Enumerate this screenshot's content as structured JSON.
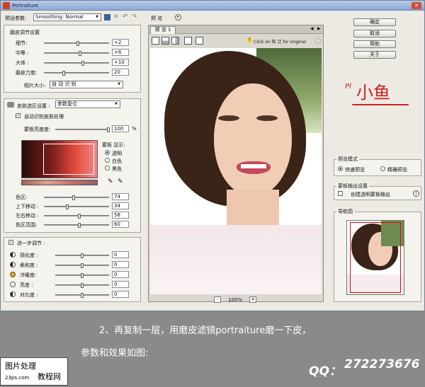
{
  "app": {
    "title": "Portraiture"
  },
  "left": {
    "preset_label": "预设参数:",
    "preset_value": "Smoothing: Normal",
    "smoothing": {
      "title": "磨皮调节设置",
      "rows": [
        {
          "label": "细节:",
          "value": "+2",
          "level": 0.52
        },
        {
          "label": "中等 :",
          "value": "+6",
          "level": 0.56
        },
        {
          "label": "大体 :",
          "value": "+10",
          "level": 0.6
        },
        {
          "label": "磨皮力度:",
          "value": "20",
          "level": 0.3
        }
      ],
      "threshold_label": "相片大小:",
      "threshold_value": "自 动 识 别"
    },
    "skin": {
      "title": "皮肤选区设置 :",
      "mode_value": "参数复位",
      "auto_label": "自动识别皮肤处理",
      "opacity_label": "蒙板亮度度:",
      "opacity_value": "100",
      "opacity_unit": "%",
      "mask_title": "蒙板 显示:",
      "mask_options": [
        "透明",
        "白色",
        "黑色"
      ],
      "rows": [
        {
          "label": "色区:",
          "value": "74",
          "level": 0.45
        },
        {
          "label": "上下移动 :",
          "value": "34",
          "level": 0.35
        },
        {
          "label": "左右移动 :",
          "value": "58",
          "level": 0.55
        },
        {
          "label": "色区范围:",
          "value": "60",
          "level": 0.55
        }
      ]
    },
    "enhance": {
      "title": "进一步调节 :",
      "rows": [
        {
          "label": "锐化度 :",
          "value": "0"
        },
        {
          "label": "柔和度 :",
          "value": "0"
        },
        {
          "label": "冷暖度:",
          "value": "0"
        },
        {
          "label": "亮度 :",
          "value": "0"
        },
        {
          "label": "对比度 :",
          "value": "0"
        }
      ]
    }
  },
  "preview": {
    "title": "预 览",
    "tab": "预 览 1",
    "hint": "Click on 恢 泛 for original",
    "zoom": "100%",
    "zoom_minus": "-",
    "zoom_plus": "+"
  },
  "right": {
    "buttons": [
      "确定",
      "取消",
      "帮助",
      "关于"
    ],
    "logo_text": "小鱼",
    "logo_prefix": "Pl",
    "preview_mode": {
      "title": "预览模式",
      "options": [
        "快速预览",
        "精确预览"
      ]
    },
    "mask_output": {
      "title": "蒙板输出设置",
      "checkbox": "创建透明蒙板输出"
    },
    "navigator": {
      "title": "导航图"
    }
  },
  "caption": {
    "line1": "2、再复制一层，用磨皮滤镜portraiture磨一下皮，",
    "line2": "参数和效果如图:"
  },
  "watermark": {
    "line1": "图片处理",
    "line2": "教程网",
    "url": "23ps.com"
  },
  "qq": {
    "label": "QQ：",
    "number": "272273676"
  }
}
